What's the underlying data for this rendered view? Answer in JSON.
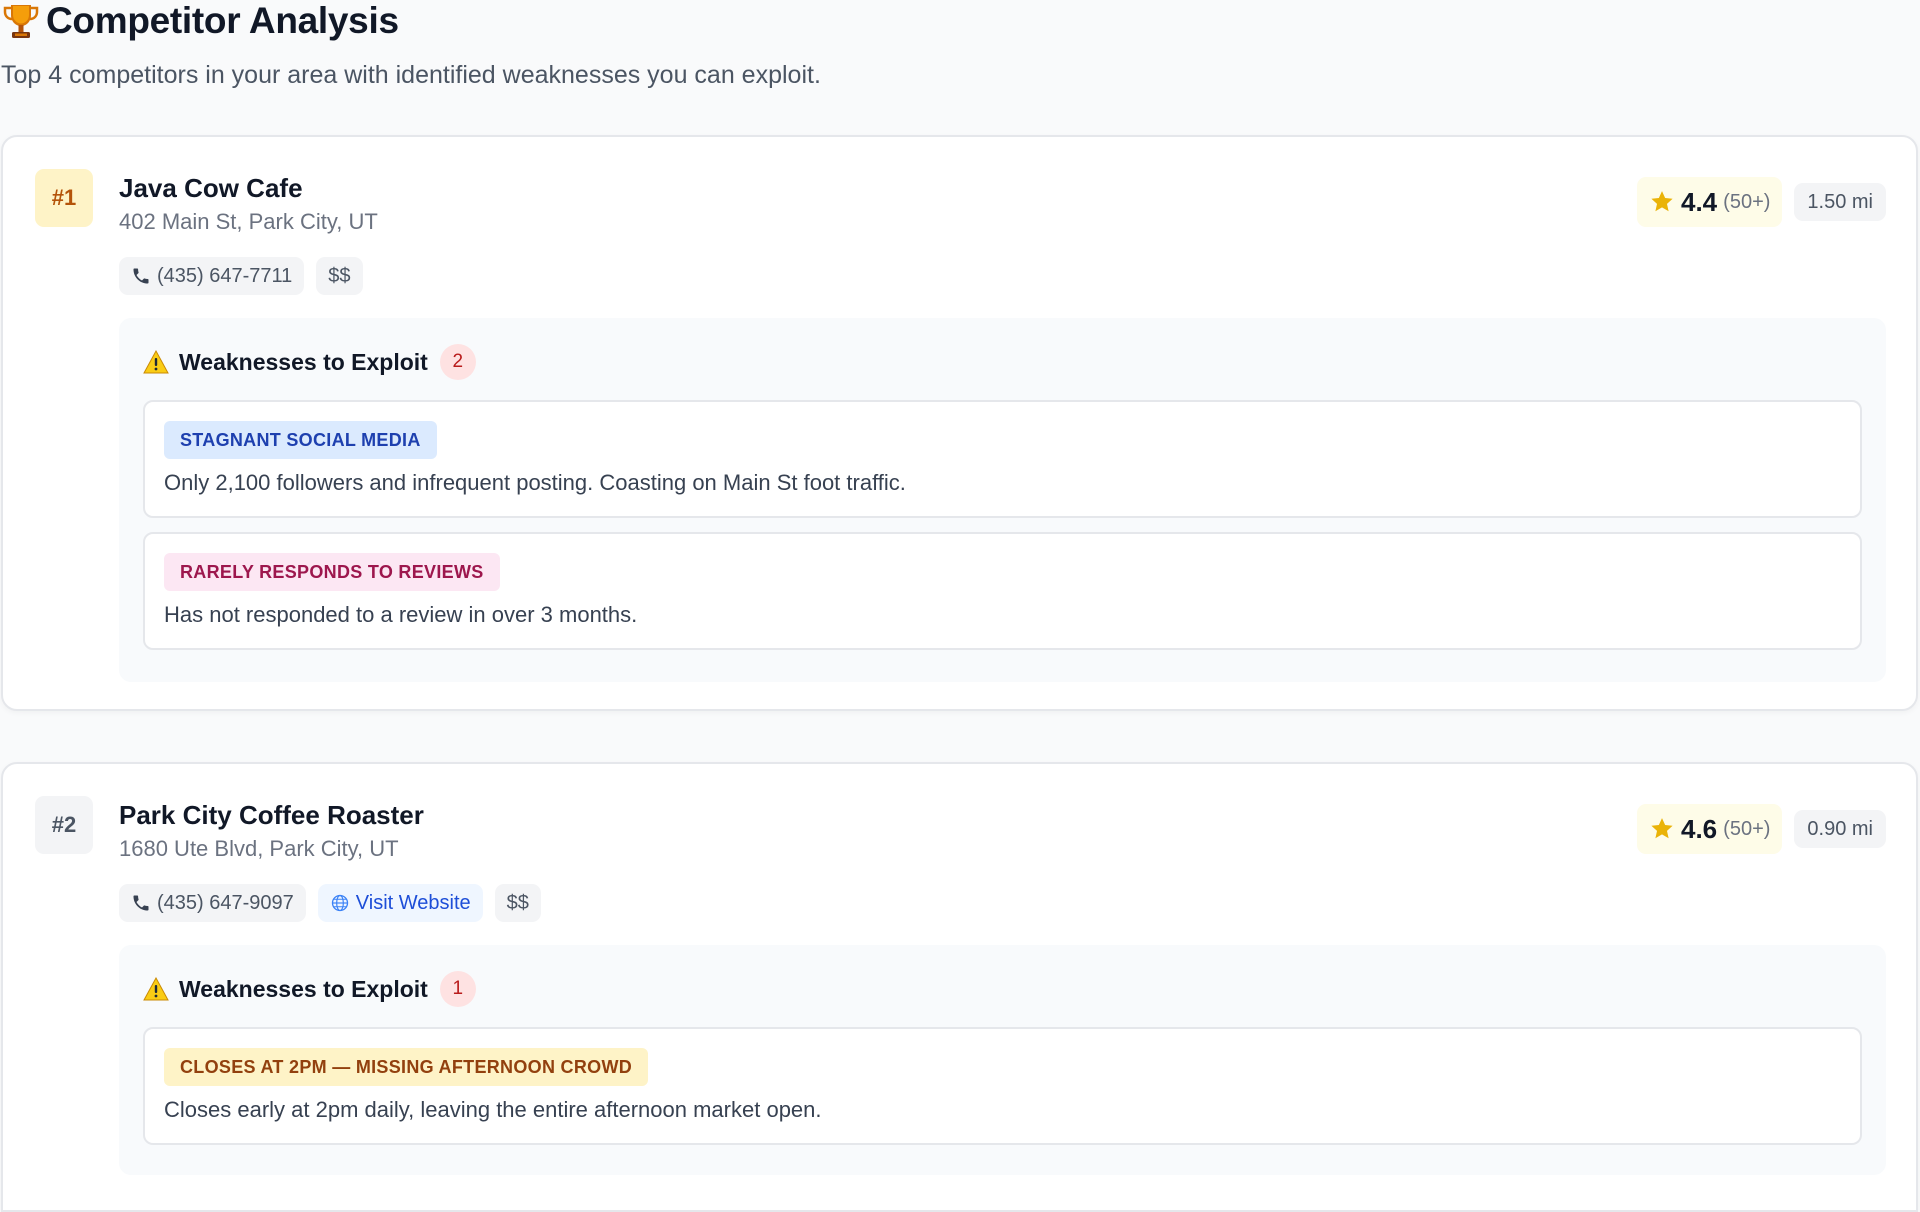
{
  "header": {
    "title": "Competitor Analysis",
    "subtitle": "Top 4 competitors in your area with identified weaknesses you can exploit."
  },
  "icons": {
    "title": "trophy-icon",
    "phone": "phone-icon",
    "globe": "globe-icon",
    "rating": "star-icon",
    "warning": "warning-icon"
  },
  "colors": {
    "rank_gold_bg": "#fef3c7",
    "rank_gold_text": "#b45309",
    "star": "#eab308",
    "weakness_count_bg": "#fee2e2",
    "link": "#1d4ed8"
  },
  "competitors": [
    {
      "rank": "#1",
      "name": "Java Cow Cafe",
      "address": "402 Main St, Park City, UT",
      "phone": "(435) 647-7711",
      "price": "$$",
      "rating": "4.4",
      "review_count": "(50+)",
      "distance": "1.50 mi",
      "weaknesses_title": "Weaknesses to Exploit",
      "weaknesses_count": "2",
      "weaknesses": [
        {
          "tag": "STAGNANT SOCIAL MEDIA",
          "description": "Only 2,100 followers and infrequent posting. Coasting on Main St foot traffic."
        },
        {
          "tag": "RARELY RESPONDS TO REVIEWS",
          "description": "Has not responded to a review in over 3 months."
        }
      ]
    },
    {
      "rank": "#2",
      "name": "Park City Coffee Roaster",
      "address": "1680 Ute Blvd, Park City, UT",
      "phone": "(435) 647-9097",
      "website_label": "Visit Website",
      "price": "$$",
      "rating": "4.6",
      "review_count": "(50+)",
      "distance": "0.90 mi",
      "weaknesses_title": "Weaknesses to Exploit",
      "weaknesses_count": "1",
      "weaknesses": [
        {
          "tag": "CLOSES AT 2PM — MISSING AFTERNOON CROWD",
          "description": "Closes early at 2pm daily, leaving the entire afternoon market open."
        }
      ]
    }
  ]
}
